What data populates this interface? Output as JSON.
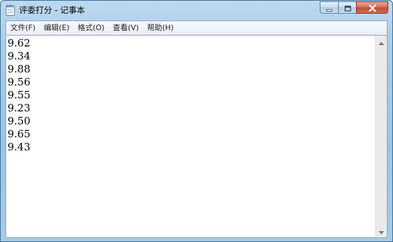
{
  "window": {
    "title": "评委打分 - 记事本",
    "app_icon": "notepad-icon",
    "caption_buttons": {
      "minimize_icon": "minimize-icon",
      "maximize_icon": "maximize-icon",
      "close_icon": "close-icon"
    }
  },
  "menu": {
    "items": [
      {
        "label": "文件(F)"
      },
      {
        "label": "编辑(E)"
      },
      {
        "label": "格式(O)"
      },
      {
        "label": "查看(V)"
      },
      {
        "label": "帮助(H)"
      }
    ]
  },
  "document": {
    "lines": [
      "9.62",
      "9.34",
      "9.88",
      "9.56",
      "9.55",
      "9.23",
      "9.50",
      "9.65",
      "9.43"
    ]
  },
  "scrollbar": {
    "up_icon": "scroll-up-arrow-icon",
    "down_icon": "scroll-down-arrow-icon"
  },
  "colors": {
    "frame": "#a9cce8",
    "close_button": "#c5472c",
    "text": "#000000",
    "editor_background": "#ffffff"
  }
}
